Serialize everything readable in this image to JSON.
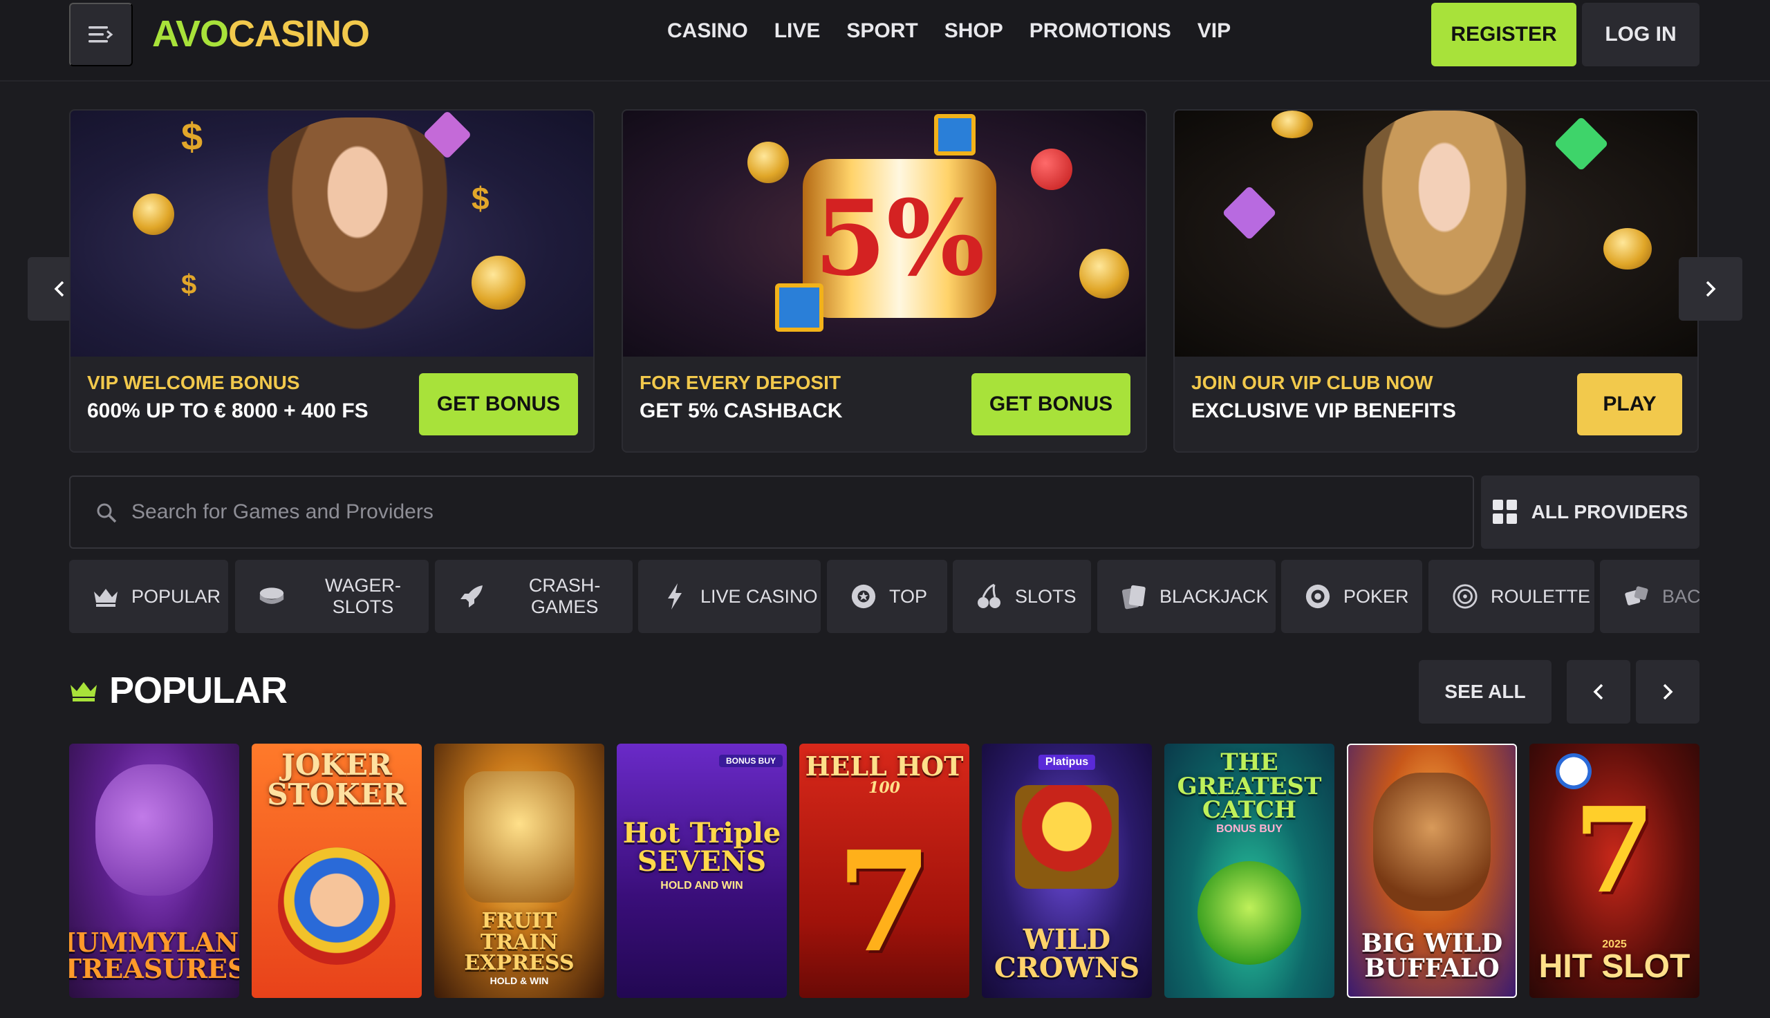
{
  "header": {
    "logo_left": "AVO",
    "logo_right": "CASINO",
    "nav": [
      "CASINO",
      "LIVE",
      "SPORT",
      "SHOP",
      "PROMOTIONS",
      "VIP"
    ],
    "register": "REGISTER",
    "login": "LOG IN"
  },
  "banners": [
    {
      "title": "VIP WELCOME BONUS",
      "subtitle": "600% UP TO € 8000 + 400 FS",
      "cta": "GET BONUS"
    },
    {
      "title": "FOR EVERY DEPOSIT",
      "subtitle": "GET 5% CASHBACK",
      "cta": "GET BONUS",
      "art_text": "5%"
    },
    {
      "title": "JOIN OUR VIP CLUB NOW",
      "subtitle": "EXCLUSIVE VIP BENEFITS",
      "cta": "PLAY"
    }
  ],
  "search": {
    "placeholder": "Search for Games and Providers"
  },
  "providers_label": "ALL PROVIDERS",
  "categories": [
    {
      "label": "POPULAR",
      "icon": "crown-icon"
    },
    {
      "label": "WAGER-SLOTS",
      "icon": "chips-icon"
    },
    {
      "label": "CRASH-GAMES",
      "icon": "rocket-icon"
    },
    {
      "label": "LIVE CASINO",
      "icon": "lightning-icon"
    },
    {
      "label": "TOP",
      "icon": "badge-icon"
    },
    {
      "label": "SLOTS",
      "icon": "cherries-icon"
    },
    {
      "label": "BLACKJACK",
      "icon": "cards-icon"
    },
    {
      "label": "POKER",
      "icon": "poker-chip-icon"
    },
    {
      "label": "ROULETTE",
      "icon": "roulette-icon"
    },
    {
      "label": "BAC",
      "icon": "dice-icon"
    }
  ],
  "popular": {
    "title": "POPULAR",
    "see_all": "SEE ALL",
    "games": [
      {
        "title": "MUMMYLAND TREASURES"
      },
      {
        "title": "JOKER STOKER"
      },
      {
        "title": "FRUIT TRAIN EXPRESS",
        "subtitle": "HOLD & WIN"
      },
      {
        "title": "Hot Triple SEVENS",
        "subtitle": "HOLD AND WIN",
        "badge": "BONUS BUY"
      },
      {
        "title": "HELL HOT",
        "subtitle": "100"
      },
      {
        "title": "WILD CROWNS",
        "badge": "Platipus"
      },
      {
        "title": "THE GREATEST CATCH",
        "subtitle": "BONUS BUY"
      },
      {
        "title": "BIG WILD BUFFALO"
      },
      {
        "title": "HIT SLOT",
        "subtitle": "2025"
      }
    ]
  },
  "colors": {
    "accent_green": "#a8e23a",
    "accent_gold": "#f2c94c",
    "bg": "#1c1c20",
    "panel": "#2a2a30"
  }
}
